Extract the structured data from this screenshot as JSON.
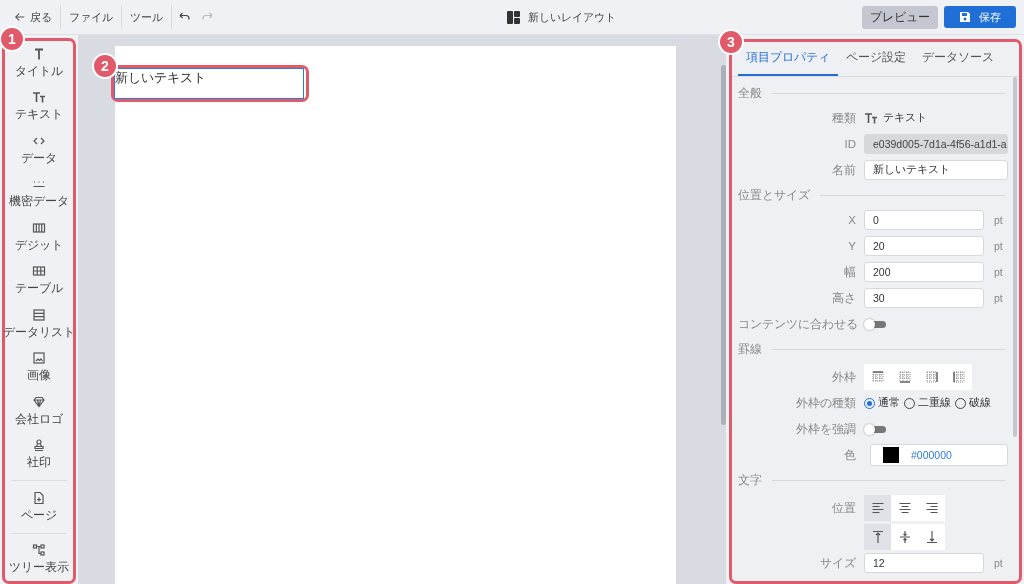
{
  "toolbar": {
    "back": "戻る",
    "menus": [
      {
        "label": "ファイル"
      },
      {
        "label": "ツール"
      }
    ],
    "undo": {
      "disabled": false
    },
    "redo": {
      "disabled": true
    },
    "title": "新しいレイアウト",
    "preview": "プレビュー",
    "save": "保存"
  },
  "sidebar": {
    "callout": "1",
    "groups": [
      [
        {
          "kind": "title",
          "label": "タイトル"
        },
        {
          "kind": "text",
          "label": "テキスト"
        },
        {
          "kind": "data",
          "label": "データ"
        },
        {
          "kind": "secret",
          "label": "機密データ"
        },
        {
          "kind": "digit",
          "label": "デジット"
        },
        {
          "kind": "table",
          "label": "テーブル"
        },
        {
          "kind": "list",
          "label": "データリスト"
        },
        {
          "kind": "image",
          "label": "画像"
        },
        {
          "kind": "logo",
          "label": "会社ロゴ"
        },
        {
          "kind": "stamp",
          "label": "社印"
        }
      ],
      [
        {
          "kind": "page",
          "label": "ページ"
        }
      ],
      [
        {
          "kind": "tree",
          "label": "ツリー表示"
        }
      ]
    ]
  },
  "canvas": {
    "callout": "2",
    "element": {
      "text": "新しいテキスト",
      "selected": true
    }
  },
  "properties": {
    "callout": "3",
    "tabs": [
      {
        "label": "項目プロパティ",
        "selected": true
      },
      {
        "label": "ページ設定",
        "selected": false
      },
      {
        "label": "データソース",
        "selected": false
      }
    ],
    "sections": [
      {
        "title": "全般",
        "rows": [
          {
            "kind": "type",
            "label": "種類",
            "value": "テキスト"
          },
          {
            "kind": "text",
            "label": "ID",
            "value": "e039d005-7d1a-4f56-a1d1-a",
            "disabled": true
          },
          {
            "kind": "text",
            "label": "名前",
            "value": "新しいテキスト",
            "disabled": false
          }
        ]
      },
      {
        "title": "位置とサイズ",
        "rows": [
          {
            "kind": "number",
            "label": "X",
            "value": "0",
            "unit": "pt"
          },
          {
            "kind": "number",
            "label": "Y",
            "value": "20",
            "unit": "pt"
          },
          {
            "kind": "number",
            "label": "幅",
            "value": "200",
            "unit": "pt"
          },
          {
            "kind": "number",
            "label": "高さ",
            "value": "30",
            "unit": "pt"
          },
          {
            "kind": "toggle",
            "label": "コンテンツに合わせる",
            "on": false
          }
        ]
      },
      {
        "title": "罫線",
        "rows": [
          {
            "kind": "borders",
            "label": "外枠",
            "buttons": [
              {
                "kind": "top"
              },
              {
                "kind": "bottom"
              },
              {
                "kind": "right"
              },
              {
                "kind": "left"
              }
            ]
          },
          {
            "kind": "radio",
            "label": "外枠の種類",
            "options": [
              {
                "label": "通常",
                "selected": true
              },
              {
                "label": "二重線",
                "selected": false
              },
              {
                "label": "破線",
                "selected": false
              }
            ]
          },
          {
            "kind": "toggle",
            "label": "外枠を強調",
            "on": false
          },
          {
            "kind": "color",
            "label": "色",
            "value": "#000000"
          }
        ]
      },
      {
        "title": "文字",
        "rows": [
          {
            "kind": "segmented",
            "label": "位置",
            "buttons": [
              {
                "kind": "align-left",
                "selected": true
              },
              {
                "kind": "align-center",
                "selected": false
              },
              {
                "kind": "align-right",
                "selected": false
              }
            ]
          },
          {
            "kind": "segmented",
            "buttons": [
              {
                "kind": "valign-top",
                "selected": true
              },
              {
                "kind": "valign-middle",
                "selected": false
              },
              {
                "kind": "valign-bottom",
                "selected": false
              }
            ]
          },
          {
            "kind": "number",
            "label": "サイズ",
            "value": "12",
            "unit": "pt"
          }
        ]
      }
    ]
  }
}
